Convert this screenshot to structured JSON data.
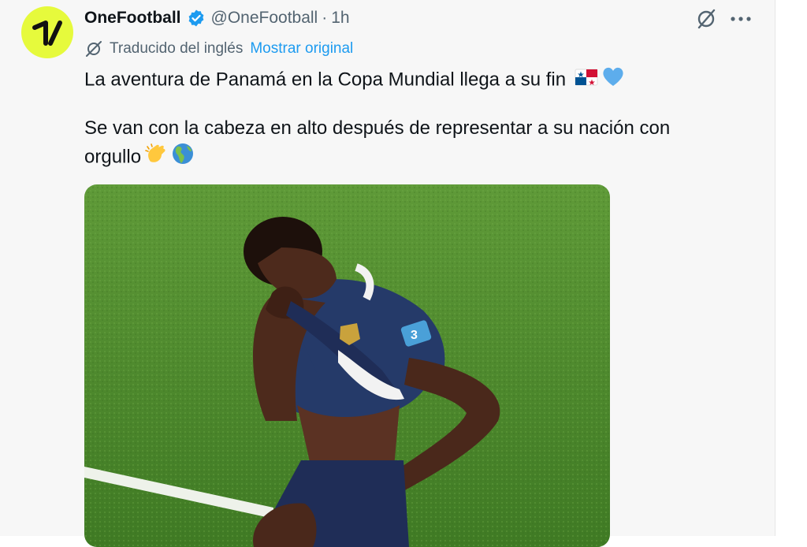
{
  "tweet": {
    "author_name": "OneFootball",
    "handle": "@OneFootball",
    "separator": "·",
    "time": "1h",
    "translated_label": "Traducido del inglés",
    "show_original": "Mostrar original",
    "line1": "La aventura de Panamá en la Copa Mundial llega a su fin",
    "line2": "Se van con la cabeza en alto después de representar a su nación con",
    "line3": "orgullo",
    "avatar_text": "1.",
    "jersey_number": "3",
    "image_description": "Panama player kneeling on the pitch covering his face with his jersey"
  },
  "colors": {
    "accent": "#1d9bf0",
    "avatar_bg": "#e6fa3c",
    "text": "#0f1419",
    "muted": "#536471",
    "pitch": "#4f8a2c",
    "jersey": "#1f2d57"
  },
  "icons": [
    "verified-badge-icon",
    "grok-icon",
    "more-icon",
    "translate-icon",
    "panama-flag-emoji",
    "blue-heart-emoji",
    "clapping-hands-emoji",
    "globe-americas-emoji"
  ]
}
